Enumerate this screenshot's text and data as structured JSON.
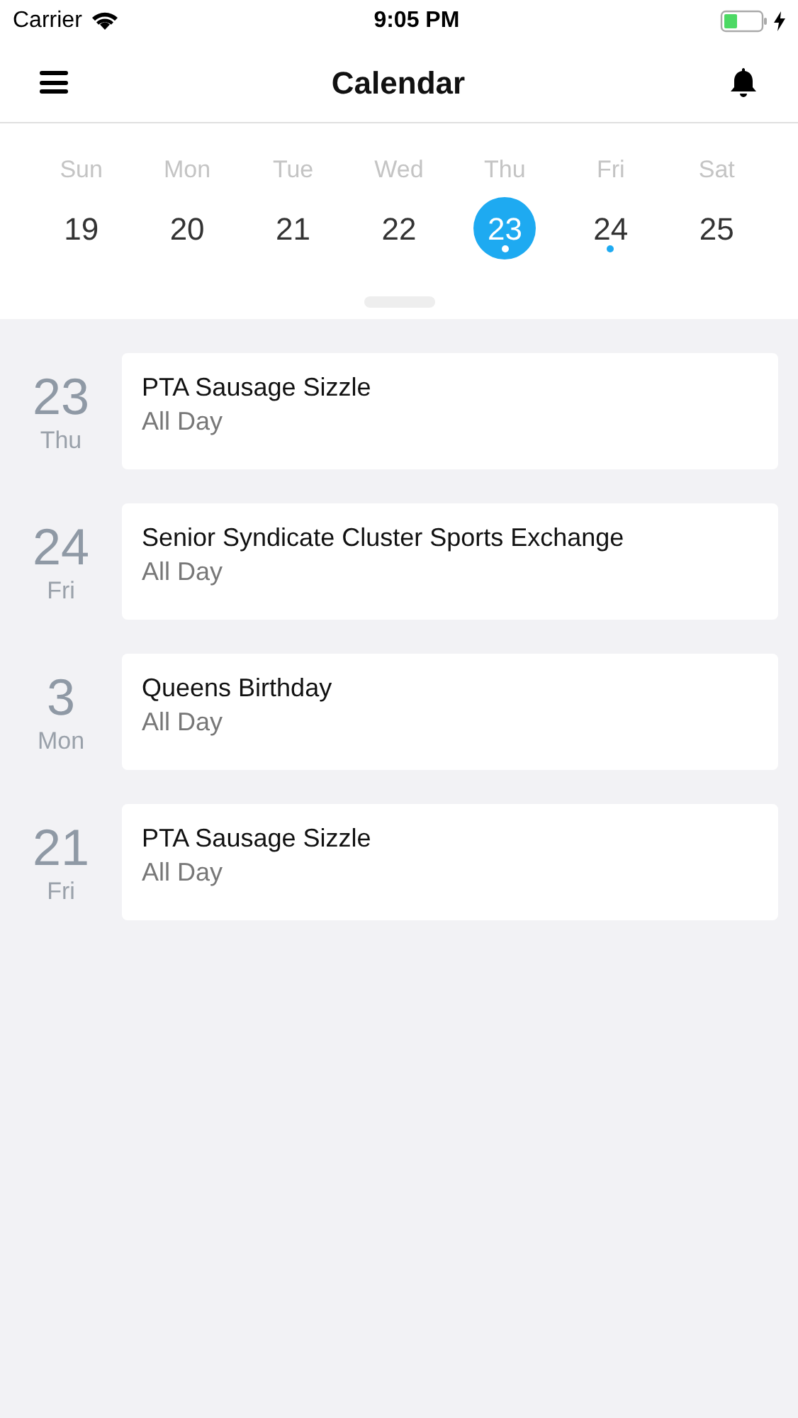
{
  "status_bar": {
    "carrier": "Carrier",
    "time": "9:05 PM"
  },
  "nav": {
    "title": "Calendar"
  },
  "week": [
    {
      "name": "Sun",
      "date": "19",
      "selected": false,
      "has_event": false
    },
    {
      "name": "Mon",
      "date": "20",
      "selected": false,
      "has_event": false
    },
    {
      "name": "Tue",
      "date": "21",
      "selected": false,
      "has_event": false
    },
    {
      "name": "Wed",
      "date": "22",
      "selected": false,
      "has_event": false
    },
    {
      "name": "Thu",
      "date": "23",
      "selected": true,
      "has_event": true
    },
    {
      "name": "Fri",
      "date": "24",
      "selected": false,
      "has_event": true
    },
    {
      "name": "Sat",
      "date": "25",
      "selected": false,
      "has_event": false
    }
  ],
  "events": [
    {
      "day": "23",
      "weekday": "Thu",
      "title": "PTA Sausage Sizzle",
      "time": "All Day"
    },
    {
      "day": "24",
      "weekday": "Fri",
      "title": "Senior Syndicate Cluster Sports Exchange",
      "time": "All Day"
    },
    {
      "day": "3",
      "weekday": "Mon",
      "title": "Queens Birthday",
      "time": "All Day"
    },
    {
      "day": "21",
      "weekday": "Fri",
      "title": "PTA Sausage Sizzle",
      "time": "All Day"
    }
  ]
}
